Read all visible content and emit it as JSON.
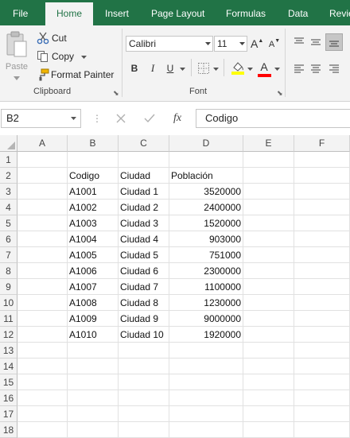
{
  "tabs": [
    {
      "label": "File"
    },
    {
      "label": "Home"
    },
    {
      "label": "Insert"
    },
    {
      "label": "Page Layout"
    },
    {
      "label": "Formulas"
    },
    {
      "label": "Data"
    },
    {
      "label": "Revie"
    }
  ],
  "active_tab": "Home",
  "ribbon": {
    "clipboard": {
      "paste_label": "Paste",
      "cut_label": "Cut",
      "copy_label": "Copy",
      "format_painter_label": "Format Painter",
      "group_label": "Clipboard"
    },
    "font": {
      "font_name": "Calibri",
      "font_size": "11",
      "bold": "B",
      "italic": "I",
      "underline": "U",
      "font_color_glyph": "A",
      "grow_glyph": "A",
      "shrink_glyph": "A",
      "group_label": "Font"
    }
  },
  "formula_bar": {
    "name_box": "B2",
    "fx": "fx",
    "value": "Codigo"
  },
  "colors": {
    "brand": "#217346",
    "highlight_yellow": "#ffff00",
    "font_red": "#ff0000"
  },
  "grid": {
    "columns": [
      "A",
      "B",
      "C",
      "D",
      "E",
      "F"
    ],
    "rows": [
      "1",
      "2",
      "3",
      "4",
      "5",
      "6",
      "7",
      "8",
      "9",
      "10",
      "11",
      "12",
      "13",
      "14",
      "15",
      "16",
      "17",
      "18"
    ],
    "header": {
      "b": "Codigo",
      "c": "Ciudad",
      "d": "Población"
    },
    "data": [
      {
        "codigo": "A1001",
        "ciudad": "Ciudad 1",
        "poblacion": "3520000"
      },
      {
        "codigo": "A1002",
        "ciudad": "Ciudad 2",
        "poblacion": "2400000"
      },
      {
        "codigo": "A1003",
        "ciudad": "Ciudad 3",
        "poblacion": "1520000"
      },
      {
        "codigo": "A1004",
        "ciudad": "Ciudad 4",
        "poblacion": "903000"
      },
      {
        "codigo": "A1005",
        "ciudad": "Ciudad 5",
        "poblacion": "751000"
      },
      {
        "codigo": "A1006",
        "ciudad": "Ciudad 6",
        "poblacion": "2300000"
      },
      {
        "codigo": "A1007",
        "ciudad": "Ciudad 7",
        "poblacion": "1100000"
      },
      {
        "codigo": "A1008",
        "ciudad": "Ciudad 8",
        "poblacion": "1230000"
      },
      {
        "codigo": "A1009",
        "ciudad": "Ciudad 9",
        "poblacion": "9000000"
      },
      {
        "codigo": "A1010",
        "ciudad": "Ciudad 10",
        "poblacion": "1920000"
      }
    ]
  }
}
